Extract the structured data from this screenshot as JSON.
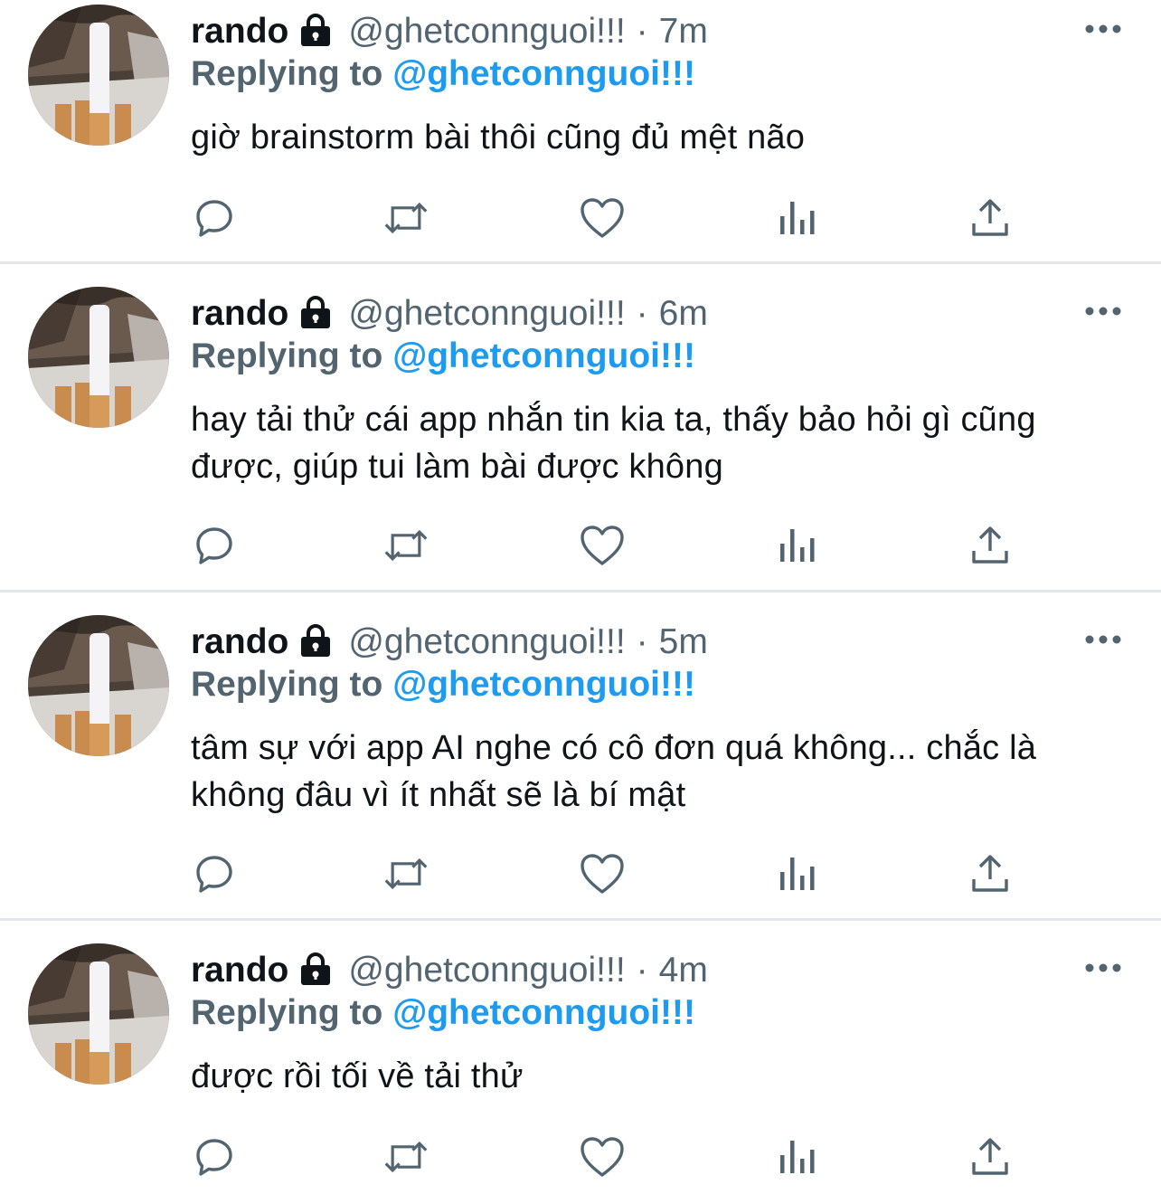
{
  "colors": {
    "text_primary": "#0f1419",
    "text_secondary": "#536471",
    "accent": "#1d9bf0",
    "divider": "#e1e6ea"
  },
  "tweets": [
    {
      "name": "rando",
      "handle": "@ghetconnguoi!!!",
      "dot": "·",
      "time": "7m",
      "replying_prefix": "Replying to",
      "replying_to": "@ghetconnguoi!!!",
      "text": "giờ brainstorm bài thôi cũng đủ mệt não",
      "icons": [
        "reply-icon",
        "retweet-icon",
        "like-icon",
        "analytics-icon",
        "share-icon"
      ]
    },
    {
      "name": "rando",
      "handle": "@ghetconnguoi!!!",
      "dot": "·",
      "time": "6m",
      "replying_prefix": "Replying to",
      "replying_to": "@ghetconnguoi!!!",
      "text": "hay tải thử cái app nhắn tin kia ta, thấy bảo hỏi gì cũng được, giúp tui làm bài được không",
      "icons": [
        "reply-icon",
        "retweet-icon",
        "like-icon",
        "analytics-icon",
        "share-icon"
      ]
    },
    {
      "name": "rando",
      "handle": "@ghetconnguoi!!!",
      "dot": "·",
      "time": "5m",
      "replying_prefix": "Replying to",
      "replying_to": "@ghetconnguoi!!!",
      "text": "tâm sự với app AI nghe có cô đơn quá không... chắc là không đâu vì ít nhất sẽ là bí mật",
      "icons": [
        "reply-icon",
        "retweet-icon",
        "like-icon",
        "analytics-icon",
        "share-icon"
      ]
    },
    {
      "name": "rando",
      "handle": "@ghetconnguoi!!!",
      "dot": "·",
      "time": "4m",
      "replying_prefix": "Replying to",
      "replying_to": "@ghetconnguoi!!!",
      "text": "được rồi tối về tải thử",
      "icons": [
        "reply-icon",
        "retweet-icon",
        "like-icon",
        "analytics-icon",
        "share-icon"
      ]
    }
  ]
}
